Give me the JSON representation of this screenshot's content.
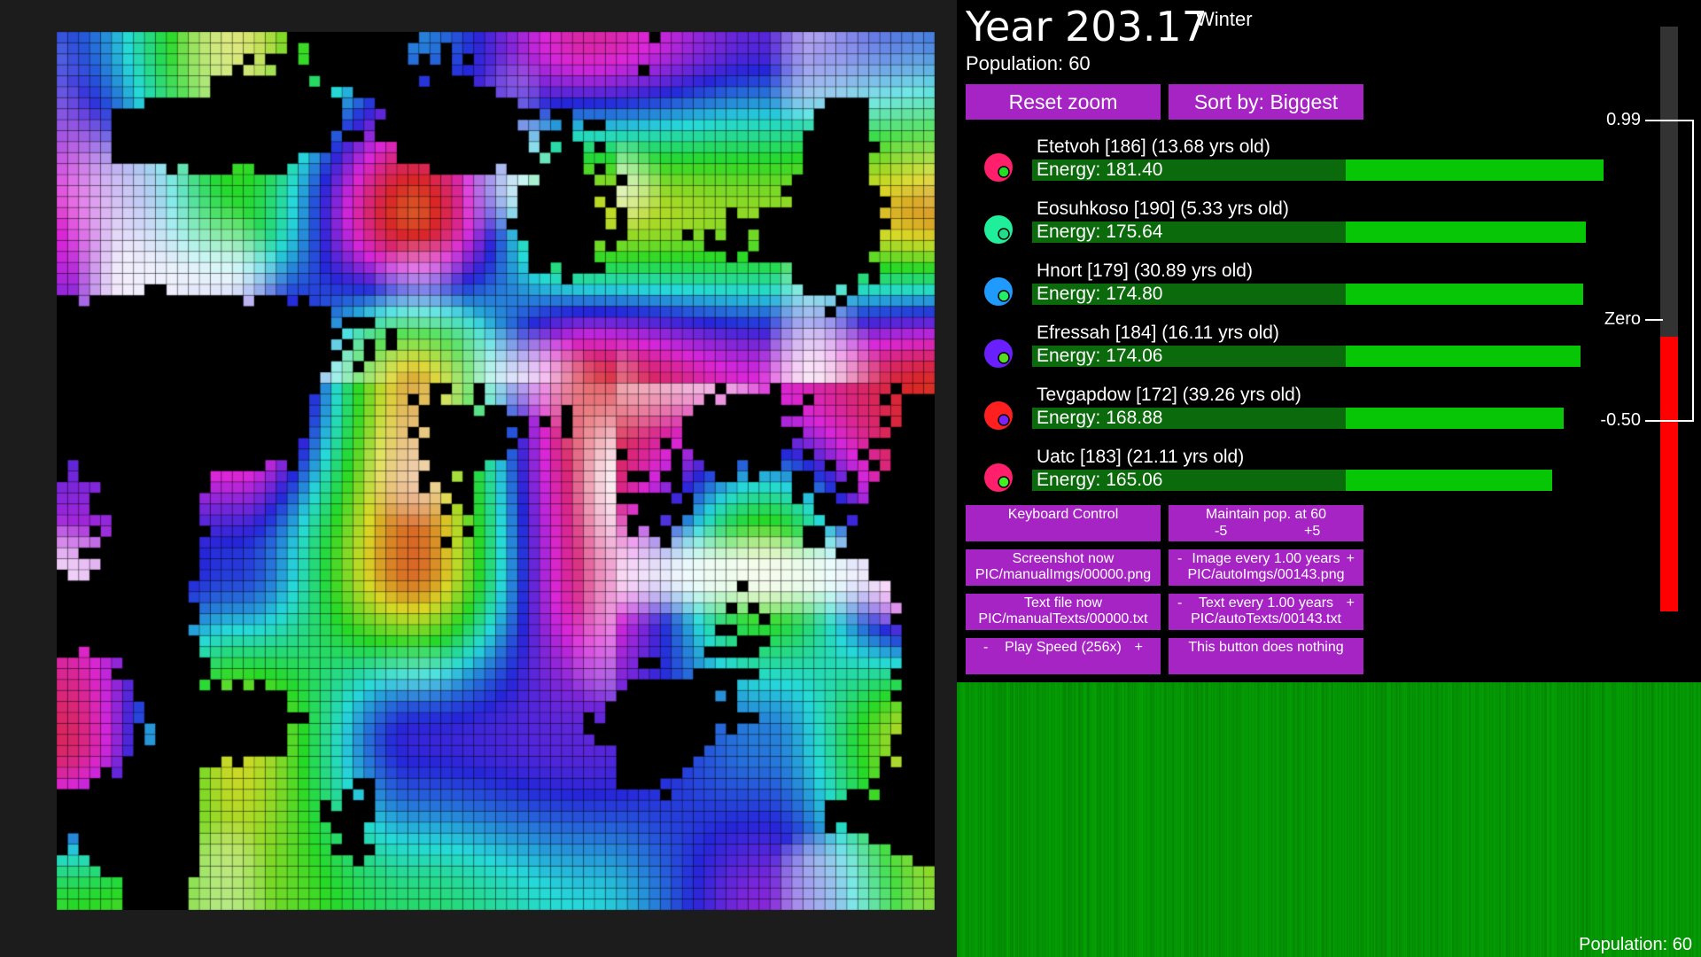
{
  "header": {
    "year": "Year 203.17",
    "season": "Winter",
    "population": "Population: 60"
  },
  "buttons": {
    "reset_zoom": "Reset zoom",
    "sort_by": "Sort by: Biggest",
    "keyboard_control": "Keyboard Control",
    "maintain_pop": "Maintain pop. at 60",
    "maintain_minus": "-5",
    "maintain_plus": "+5",
    "screenshot_now": "Screenshot now",
    "screenshot_path": "PIC/manualImgs/00000.png",
    "image_every": "Image every 1.00 years",
    "image_every_path": "PIC/autoImgs/00143.png",
    "text_file_now": "Text file now",
    "text_file_path": "PIC/manualTexts/00000.txt",
    "text_every": "Text every 1.00 years",
    "text_every_path": "PIC/autoTexts/00143.txt",
    "play_speed": "Play Speed (256x)",
    "nothing": "This button does nothing",
    "minus": "-",
    "plus": "+"
  },
  "creatures": [
    {
      "name": "Etetvoh [186] (13.68 yrs old)",
      "energy": "Energy: 181.40",
      "energy_value": 181.4,
      "body_color": "#ff1f6a",
      "eye_color": "#22dd22"
    },
    {
      "name": "Eosuhkoso [190] (5.33 yrs old)",
      "energy": "Energy: 175.64",
      "energy_value": 175.64,
      "body_color": "#1fee9a",
      "eye_color": "#22dd88"
    },
    {
      "name": "Hnort [179] (30.89 yrs old)",
      "energy": "Energy: 174.80",
      "energy_value": 174.8,
      "body_color": "#1f9aff",
      "eye_color": "#22ee66"
    },
    {
      "name": "Efressah [184] (16.11 yrs old)",
      "energy": "Energy: 174.06",
      "energy_value": 174.06,
      "body_color": "#6a1fff",
      "eye_color": "#55dd22"
    },
    {
      "name": "Tevgapdow [172] (39.26 yrs old)",
      "energy": "Energy: 168.88",
      "energy_value": 168.88,
      "body_color": "#ff1f1f",
      "eye_color": "#7722ff"
    },
    {
      "name": "Uatc [183] (21.11 yrs old)",
      "energy": "Energy: 165.06",
      "energy_value": 165.06,
      "body_color": "#ff1f6a",
      "eye_color": "#44ee22"
    }
  ],
  "scale": {
    "max_label": "0.99",
    "zero_label": "Zero",
    "min_label": "-0.50",
    "max_value": 0.99,
    "min_value": -0.5,
    "bar_range": [
      -1.45,
      1.45
    ],
    "negative_color": "#ff0000"
  },
  "graph": {
    "population_label": "Population: 60",
    "color": "#0aa00a"
  },
  "colors": {
    "button": "#a624c4",
    "energy_full": "#06c606",
    "energy_dark": "#0b6a0b"
  }
}
